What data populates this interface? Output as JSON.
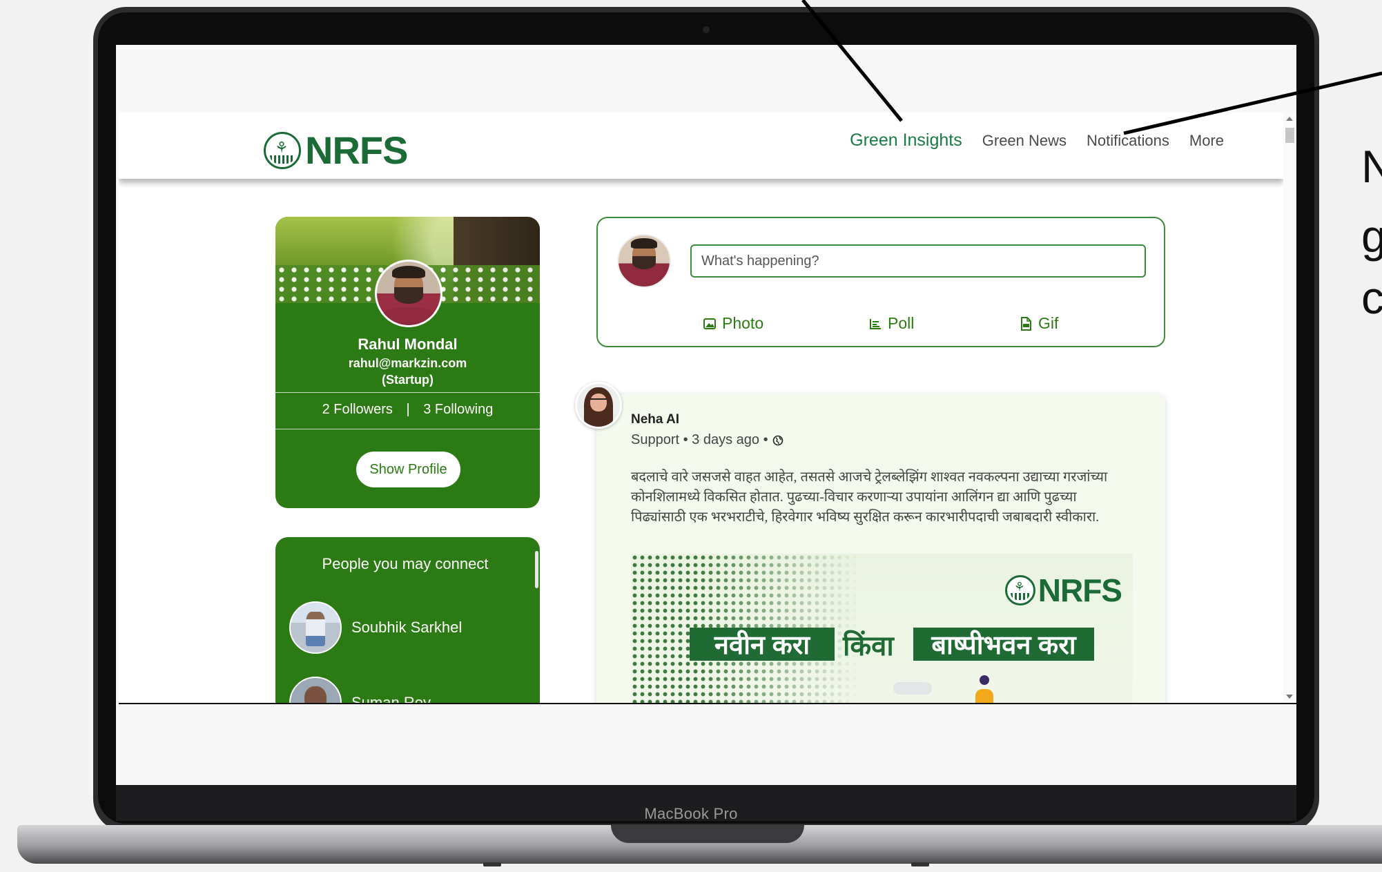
{
  "device": {
    "brand": "MacBook Pro"
  },
  "navbar": {
    "logo_text": "NRFS",
    "links": [
      {
        "label": "Green Insights",
        "active": true
      },
      {
        "label": "Green News"
      },
      {
        "label": "Notifications"
      },
      {
        "label": "More"
      }
    ]
  },
  "profile": {
    "name": "Rahul Mondal",
    "email": "rahul@markzin.com",
    "type": "(Startup)",
    "followers": "2 Followers",
    "separator": "|",
    "following": "3 Following",
    "button_label": "Show Profile"
  },
  "people": {
    "title": "People you may connect",
    "items": [
      {
        "name": "Soubhik Sarkhel"
      },
      {
        "name": "Suman Roy"
      }
    ]
  },
  "composer": {
    "placeholder": "What's happening?",
    "actions": [
      {
        "label": "Photo",
        "icon": "image-icon"
      },
      {
        "label": "Poll",
        "icon": "poll-icon"
      },
      {
        "label": "Gif",
        "icon": "gif-file-icon"
      }
    ]
  },
  "post": {
    "author": "Neha AI",
    "meta": "Support • 3 days ago •",
    "text": "बदलाचे वारे जसजसे वाहत आहेत, तसतसे आजचे ट्रेलब्लेझिंग शाश्वत नवकल्पना उद्याच्या गरजांच्या कोनशिलामध्ये विकसित होतात. पुढच्या-विचार करणाऱ्या उपायांना आलिंगन द्या आणि पुढच्या पिढ्यांसाठी एक भरभराटीचे, हिरवेगार भविष्य सुरक्षित करून कारभारीपदाची जबाबदारी स्वीकारा.",
    "image": {
      "logo_text": "NRFS",
      "left_box": "नवीन करा",
      "middle": "किंवा",
      "right_box": "बाष्पीभवन करा"
    }
  },
  "callout": {
    "lines": [
      "N",
      "g",
      "c"
    ]
  },
  "colors": {
    "brand_green": "#1a6b35",
    "card_green": "#2c7a13",
    "active_link": "#1a7a47"
  }
}
